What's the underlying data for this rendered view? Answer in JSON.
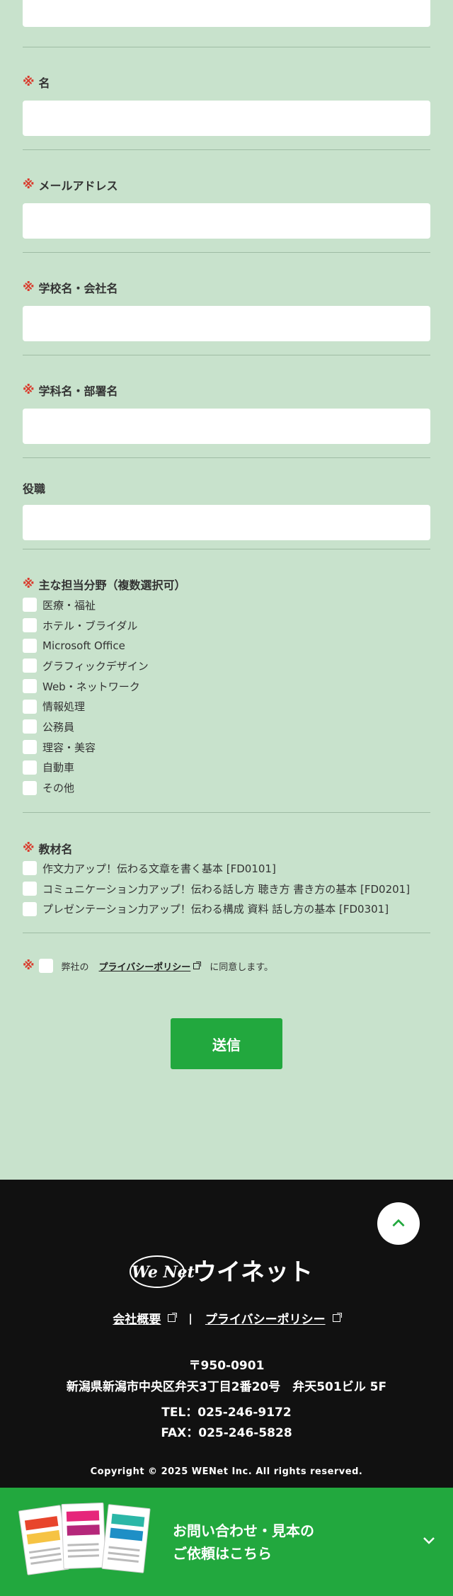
{
  "form": {
    "required_mark": "※",
    "fields": {
      "first_name": {
        "label": "名",
        "value": ""
      },
      "email": {
        "label": "メールアドレス",
        "value": ""
      },
      "school_company": {
        "label": "学校名・会社名",
        "value": ""
      },
      "department": {
        "label": "学科名・部署名",
        "value": ""
      },
      "position": {
        "label": "役職",
        "value": ""
      }
    },
    "areas": {
      "label": "主な担当分野（複数選択可）",
      "options": [
        "医療・福祉",
        "ホテル・ブライダル",
        "Microsoft Office",
        "グラフィックデザイン",
        "Web・ネットワーク",
        "情報処理",
        "公務員",
        "理容・美容",
        "自動車",
        "その他"
      ]
    },
    "materials": {
      "label": "教材名",
      "options": [
        "作文力アップ！伝わる文章を書く基本 [FD0101]",
        "コミュニケーション力アップ！伝わる話し方 聴き方 書き方の基本 [FD0201]",
        "プレゼンテーション力アップ！伝わる構成 資料 話し方の基本 [FD0301]"
      ]
    },
    "agree": {
      "prefix": "弊社の",
      "link": "プライバシーポリシー",
      "suffix": "に同意します。"
    },
    "submit_label": "送信"
  },
  "footer": {
    "logo_text": "We Net ウイネット",
    "links": [
      "会社概要",
      "プライバシーポリシー"
    ],
    "separator": "|",
    "postal": "〒950-0901",
    "address": "新潟県新潟市中央区弁天3丁目2番20号　弁天501ビル 5F",
    "tel": "TEL：025-246-9172",
    "fax": "FAX：025-246-5828",
    "copyright": "Copyright © 2025 WENet Inc. All rights reserved."
  },
  "cta": {
    "line1": "お問い合わせ・見本の",
    "line2": "ご依頼はこちら"
  },
  "colors": {
    "accent": "#22a83e",
    "form_bg": "#c8e2cc",
    "footer_bg": "#111111",
    "required": "#d93a2b"
  }
}
